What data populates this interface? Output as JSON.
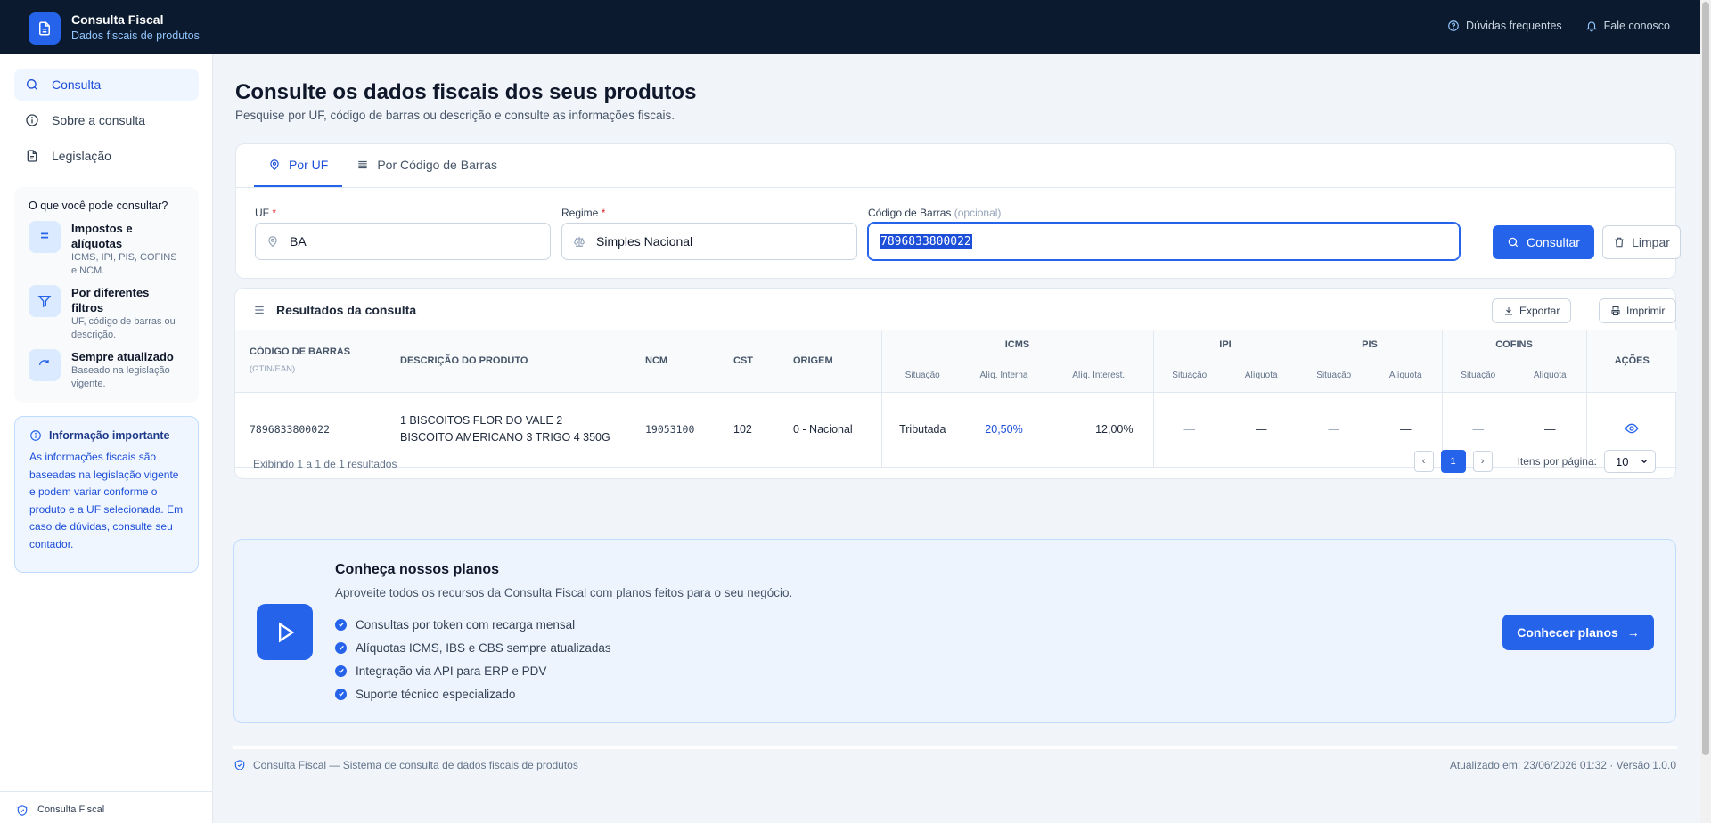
{
  "header": {
    "brand_title": "Consulta Fiscal",
    "brand_subtitle": "Dados fiscais de produtos",
    "links": [
      {
        "label": "Dúvidas frequentes",
        "icon": "help-circle-icon"
      },
      {
        "label": "Fale conosco",
        "icon": "bell-icon"
      }
    ]
  },
  "sidebar": {
    "items": [
      {
        "label": "Consulta",
        "icon": "search-icon",
        "active": true
      },
      {
        "label": "Sobre a consulta",
        "icon": "info-icon",
        "active": false
      },
      {
        "label": "Legislação",
        "icon": "document-icon",
        "active": false
      }
    ],
    "info_card": {
      "title": "O que você pode consultar?",
      "features": [
        {
          "icon_text": "=",
          "title": "Impostos e alíquotas",
          "desc": "ICMS, IPI, PIS, COFINS e NCM."
        },
        {
          "icon_text": "",
          "title": "Por diferentes filtros",
          "desc": "UF, código de barras ou descrição."
        },
        {
          "icon_text": "",
          "title": "Sempre atualizado",
          "desc": "Baseado na legislação vigente."
        }
      ]
    },
    "important": {
      "title": "Informação importante",
      "text": "As informações fiscais são baseadas na legislação vigente e podem variar conforme o produto e a UF selecionada. Em caso de dúvidas, consulte seu contador."
    },
    "footer_label": "Consulta Fiscal"
  },
  "main": {
    "title": "Consulte os dados fiscais dos seus produtos",
    "subtitle": "Pesquise por UF, código de barras ou descrição e consulte as informações fiscais."
  },
  "search": {
    "tabs": [
      {
        "label": "Por UF",
        "icon": "map-pin-icon",
        "active": true
      },
      {
        "label": "Por Código de Barras",
        "icon": "barcode-icon",
        "active": false
      }
    ],
    "uf": {
      "label": "UF",
      "required": "*",
      "value": "BA"
    },
    "regime": {
      "label": "Regime",
      "required": "*",
      "value": "Simples Nacional"
    },
    "barcode": {
      "label": "Código de Barras",
      "optional": "(opcional)",
      "value": "7896833800022"
    },
    "consultar_label": "Consultar",
    "limpar_label": "Limpar"
  },
  "results": {
    "title": "Resultados da consulta",
    "export_label": "Exportar",
    "print_label": "Imprimir",
    "columns": {
      "barcode": "CÓDIGO DE BARRAS",
      "barcode_sub": "(GTIN/EAN)",
      "desc": "DESCRIÇÃO DO PRODUTO",
      "ncm": "NCM",
      "cst": "CST",
      "origem": "ORIGEM",
      "icms": "ICMS",
      "ipi": "IPI",
      "pis": "PIS",
      "cofins": "COFINS",
      "acoes": "AÇÕES",
      "situacao": "Situação",
      "aliquota": "Alíquota",
      "aliq_interna": "Alíq. Interna",
      "aliq_interest": "Alíq. Interest."
    },
    "rows": [
      {
        "barcode": "7896833800022",
        "desc": "1 BISCOITOS FLOR DO VALE 2 BISCOITO AMERICANO 3 TRIGO 4 350G",
        "ncm": "19053100",
        "cst": "102",
        "origem": "0 - Nacional",
        "icms_situacao": "Tributada",
        "icms_interna": "20,50%",
        "icms_interest": "12,00%",
        "ipi_situacao": "—",
        "ipi_aliquota": "—",
        "pis_situacao": "—",
        "pis_aliquota": "—",
        "cofins_situacao": "—",
        "cofins_aliquota": "—"
      }
    ],
    "showing": "Exibindo 1 a 1 de 1 resultados",
    "prev": "‹",
    "current_page": "1",
    "next": "›",
    "per_page_label": "Itens por página:",
    "per_page_value": "10"
  },
  "plans": {
    "title": "Conheça nossos planos",
    "subtitle": "Aproveite todos os recursos da Consulta Fiscal com planos feitos para o seu negócio.",
    "items": [
      "Consultas por token com recarga mensal",
      "Alíquotas ICMS, IBS e CBS sempre atualizadas",
      "Integração via API para ERP e PDV",
      "Suporte técnico especializado"
    ],
    "cta_label": "Conhecer planos",
    "cta_arrow": "→"
  },
  "footer": {
    "left": "Consulta Fiscal — Sistema de consulta de dados fiscais de produtos",
    "right": "Atualizado em: 23/06/2026 01:32 · Versão 1.0.0"
  },
  "colors": {
    "accent": "#2563eb",
    "topbar": "#0b1a2e"
  }
}
